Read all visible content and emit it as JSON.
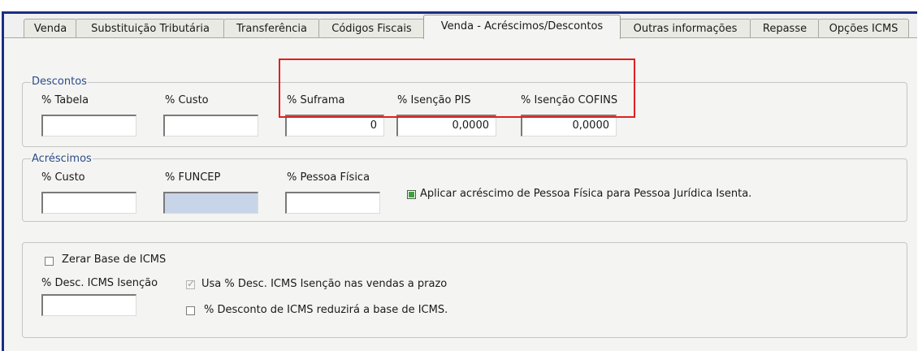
{
  "tabs": [
    {
      "label": "Venda"
    },
    {
      "label": "Substituição Tributária"
    },
    {
      "label": "Transferência"
    },
    {
      "label": "Códigos Fiscais"
    },
    {
      "label": "Venda - Acréscimos/Descontos",
      "active": true
    },
    {
      "label": "Outras informações"
    },
    {
      "label": "Repasse"
    },
    {
      "label": "Opções ICMS"
    }
  ],
  "descontos": {
    "legend": "Descontos",
    "tabela_label": "% Tabela",
    "custo_label": "% Custo",
    "suframa_label": "% Suframa",
    "suframa_value": "0",
    "pis_label": "% Isenção PIS",
    "pis_value": "0,0000",
    "cofins_label": "% Isenção COFINS",
    "cofins_value": "0,0000"
  },
  "acrescimos": {
    "legend": "Acréscimos",
    "custo_label": "% Custo",
    "funcep_label": "% FUNCEP",
    "pessoa_fisica_label": "% Pessoa Física",
    "aplicar_label": "Aplicar acréscimo de Pessoa Física para Pessoa Jurídica Isenta."
  },
  "icms": {
    "zerar_label": "Zerar Base de ICMS",
    "desc_isencao_label": "% Desc. ICMS Isenção",
    "usa_prazo_label": "Usa % Desc. ICMS Isenção nas vendas a prazo",
    "reduzira_label": "% Desconto de ICMS reduzirá a base de ICMS."
  },
  "colors": {
    "frame": "#1b2d86",
    "highlight": "#e02020",
    "legend_text": "#2d4b8a",
    "disabled_field": "#c8d4e8",
    "check_green": "#3f9f3f"
  }
}
